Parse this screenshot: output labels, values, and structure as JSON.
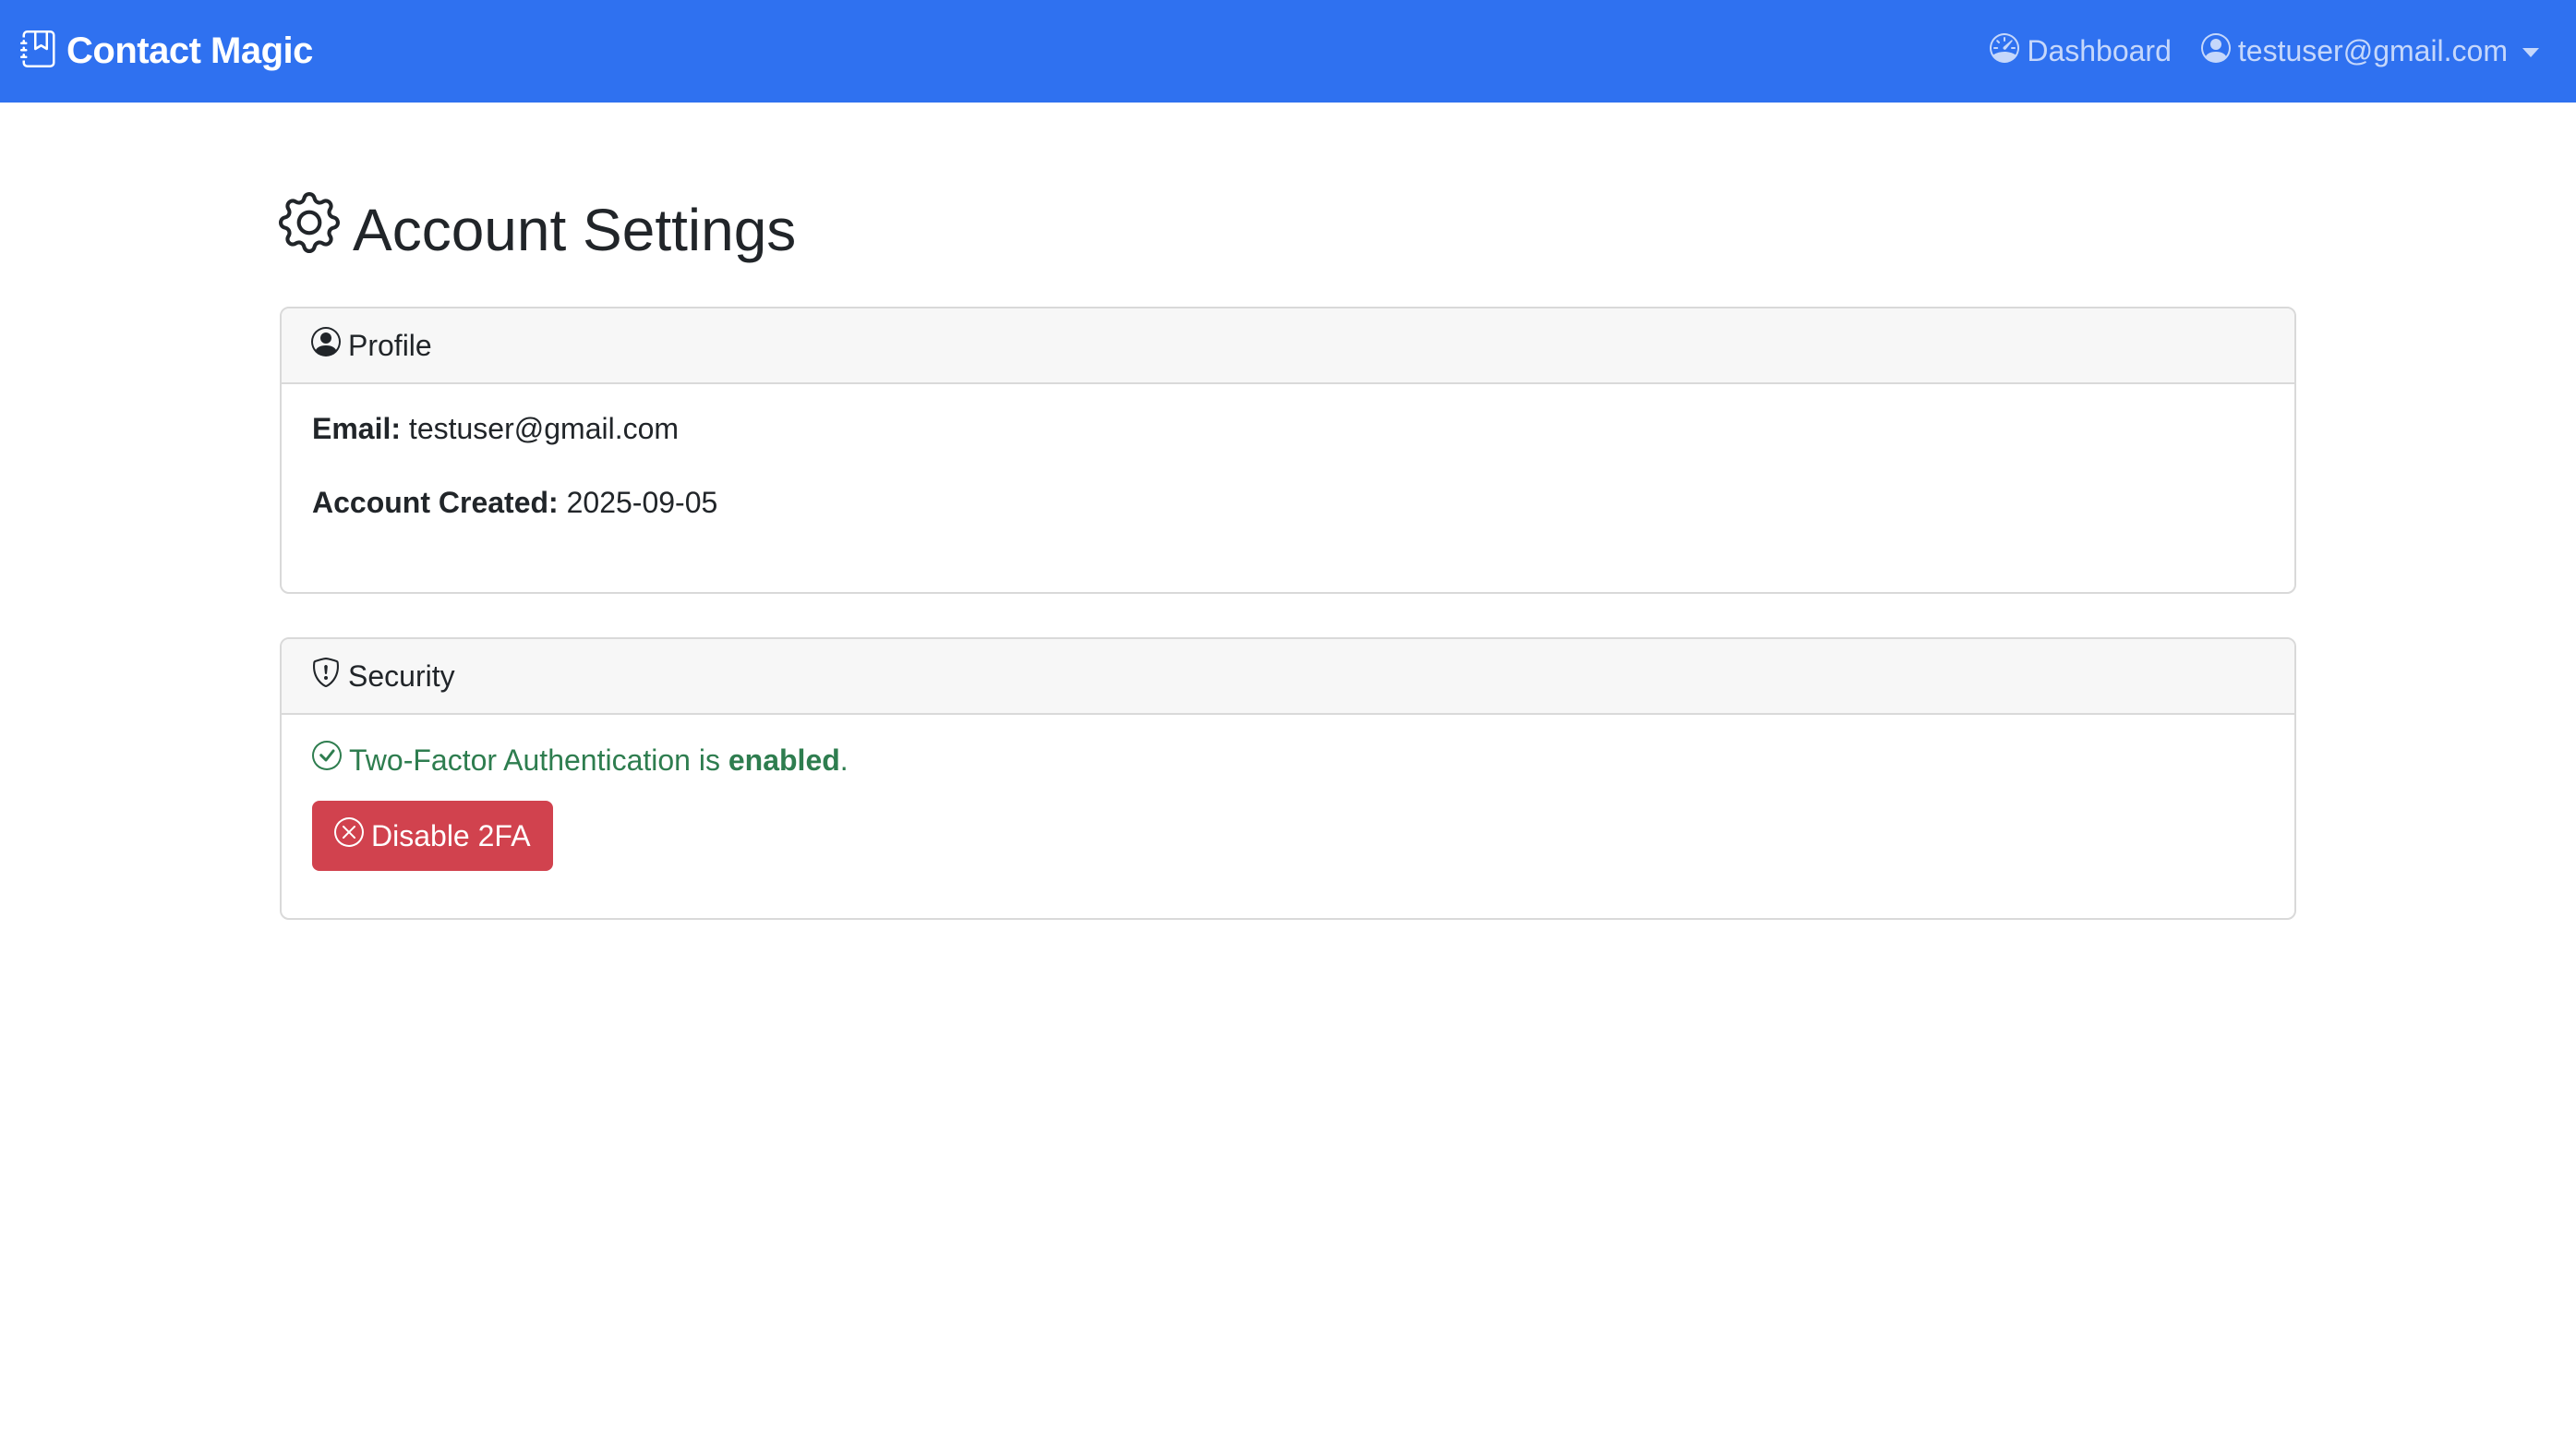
{
  "navbar": {
    "brand": "Contact Magic",
    "brand_icon": "journal-bookmark-icon",
    "dashboard_label": "Dashboard",
    "dashboard_icon": "speedometer-icon",
    "user_label": "testuser@gmail.com",
    "user_icon": "person-circle-icon",
    "background_color": "#2f71f0"
  },
  "page": {
    "title": "Account Settings",
    "title_icon": "gear-icon"
  },
  "profile_card": {
    "header": "Profile",
    "header_icon": "person-circle-icon",
    "email_label": "Email:",
    "email_value": "testuser@gmail.com",
    "created_label": "Account Created:",
    "created_value": "2025-09-05"
  },
  "security_card": {
    "header": "Security",
    "header_icon": "shield-exclamation-icon",
    "status_text_prefix": "Two-Factor Authentication is",
    "status_text_strong": "enabled",
    "status_text_suffix": ".",
    "status_icon": "check-circle-icon",
    "status_color": "#2e7d4f",
    "disable_button_label": "Disable 2FA",
    "disable_button_icon": "x-circle-icon",
    "disable_button_color": "#d1424e"
  }
}
